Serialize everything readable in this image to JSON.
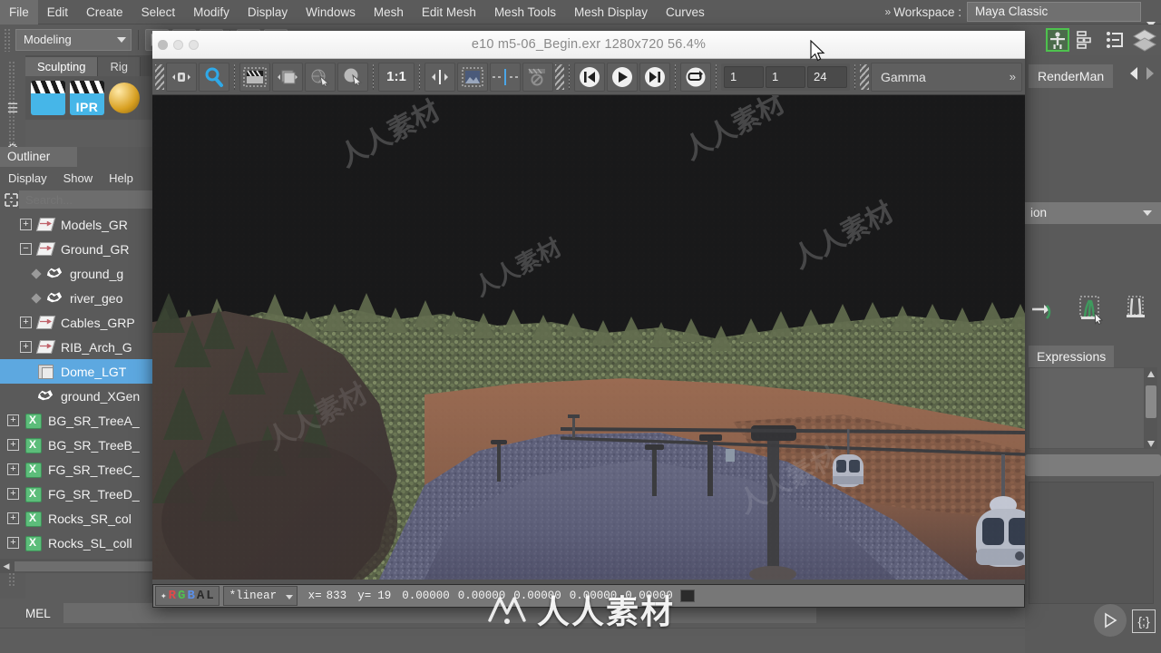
{
  "app": {
    "menubar": {
      "items": [
        "File",
        "Edit",
        "Create",
        "Select",
        "Modify",
        "Display",
        "Windows",
        "Mesh",
        "Edit Mesh",
        "Mesh Tools",
        "Mesh Display",
        "Curves"
      ],
      "workspace_chevron": "»",
      "workspace_label": "Workspace :",
      "workspace_value": "Maya Classic"
    },
    "statusline": {
      "mode": "Modeling"
    },
    "shelf": {
      "tabs": [
        "Sculpting",
        "Rig"
      ],
      "active_tab": "Sculpting",
      "ipr_label": "IPR"
    },
    "mel": {
      "label": "MEL",
      "value": ""
    }
  },
  "outliner": {
    "title": "Outliner",
    "menus": [
      "Display",
      "Show",
      "Help"
    ],
    "search_placeholder": "Search...",
    "rows": [
      {
        "label": "Models_GR",
        "icon": "transform-icon",
        "expander": "+",
        "depth": 1,
        "type": "transform",
        "selected": false
      },
      {
        "label": "Ground_GR",
        "icon": "transform-icon",
        "expander": "−",
        "depth": 1,
        "type": "transform",
        "selected": false
      },
      {
        "label": "ground_g",
        "icon": "mesh-icon",
        "expander": "",
        "depth": 2,
        "type": "mesh",
        "selected": false
      },
      {
        "label": "river_geo",
        "icon": "mesh-icon",
        "expander": "",
        "depth": 2,
        "type": "mesh",
        "selected": false
      },
      {
        "label": "Cables_GRP",
        "icon": "transform-icon",
        "expander": "+",
        "depth": 1,
        "type": "transform",
        "selected": false
      },
      {
        "label": "RIB_Arch_G",
        "icon": "transform-icon",
        "expander": "+",
        "depth": 1,
        "type": "transform",
        "selected": false
      },
      {
        "label": "Dome_LGT",
        "icon": "light-icon",
        "expander": "",
        "depth": 1,
        "type": "light",
        "selected": true
      },
      {
        "label": "ground_XGen",
        "icon": "mesh-icon",
        "expander": "",
        "depth": 1,
        "type": "mesh",
        "selected": false
      },
      {
        "label": "BG_SR_TreeA_",
        "icon": "xgen-icon",
        "expander": "+",
        "depth": 0,
        "type": "xgen",
        "selected": false
      },
      {
        "label": "BG_SR_TreeB_",
        "icon": "xgen-icon",
        "expander": "+",
        "depth": 0,
        "type": "xgen",
        "selected": false
      },
      {
        "label": "FG_SR_TreeC_",
        "icon": "xgen-icon",
        "expander": "+",
        "depth": 0,
        "type": "xgen",
        "selected": false
      },
      {
        "label": "FG_SR_TreeD_",
        "icon": "xgen-icon",
        "expander": "+",
        "depth": 0,
        "type": "xgen",
        "selected": false
      },
      {
        "label": "Rocks_SR_col",
        "icon": "xgen-icon",
        "expander": "+",
        "depth": 0,
        "type": "xgen",
        "selected": false
      },
      {
        "label": "Rocks_SL_coll",
        "icon": "xgen-icon",
        "expander": "+",
        "depth": 0,
        "type": "xgen",
        "selected": false
      }
    ]
  },
  "right_panel": {
    "tab": "RenderMan",
    "combo_value": "ion",
    "section_tab": "Expressions"
  },
  "viewer": {
    "title": "e10 m5-06_Begin.exr 1280x720 56.4%",
    "toolbar": {
      "icons": [
        "pan-zoom-icon",
        "magnify-icon",
        "film-strip-icon",
        "image-sequence-icon",
        "sphere-select-icon",
        "shading-select-icon"
      ],
      "zoom_reset_label": "1:1",
      "playback": {
        "start_label": "go-to-start-icon",
        "play_label": "play-icon",
        "end_label": "go-to-end-icon",
        "loop_label": "loop-icon"
      },
      "frame_fields": [
        "1",
        "1",
        "24"
      ],
      "gamma_label": "Gamma",
      "gamma_chevron": "»"
    },
    "status": {
      "channels": [
        "R",
        "G",
        "B",
        "A",
        "L"
      ],
      "colorspace": "*linear",
      "x_label": "x=",
      "x_value": "833",
      "y_label": "y=",
      "y_value": "19",
      "values": [
        "0.00000",
        "0.00000",
        "0.00000",
        "0.00000",
        "0.00000"
      ]
    },
    "image": {
      "description": "Rendered 3D mountain scene: dark night sky, pine tree ridge line, red-dirt slope, gravel river bed, lamp posts, overhead cable with two gondola cabins",
      "sky_color": "#161616",
      "tree_color": "#6e7a5c",
      "dirt_color": "#9b6b52",
      "river_color": "#5c5d75"
    }
  },
  "watermark": {
    "brand": "人人素材",
    "tiles": [
      "人人素材",
      "人人素材",
      "人人素材",
      "人人素材",
      "人人素材",
      "人人素材"
    ]
  },
  "colors": {
    "accent": "#5da8e0",
    "shelf_blue": "#46b6e8",
    "panel_bg": "#5a5a5a",
    "menubar_bg": "#5b5b5b",
    "xgen_green": "#5cbd7a"
  }
}
